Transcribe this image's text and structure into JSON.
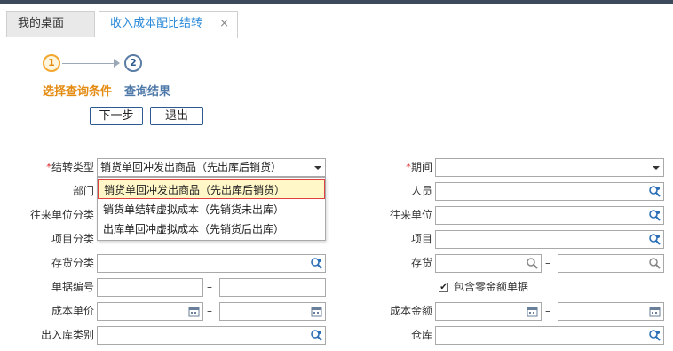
{
  "tabs": {
    "home": "我的桌面",
    "active": "收入成本配比结转",
    "close": "×"
  },
  "steps": [
    {
      "num": "1",
      "label": "选择查询条件"
    },
    {
      "num": "2",
      "label": "查询结果"
    }
  ],
  "buttons": {
    "next": "下一步",
    "exit": "退出"
  },
  "form": {
    "transfer_type": {
      "label": "结转类型",
      "value": "销货单回冲发出商品（先出库后销货）"
    },
    "department": {
      "label": "部门"
    },
    "partner_category": {
      "label": "往来单位分类"
    },
    "project_category": {
      "label": "项目分类"
    },
    "inventory_category": {
      "label": "存货分类"
    },
    "doc_number": {
      "label": "单据编号"
    },
    "cost_price": {
      "label": "成本单价"
    },
    "io_category": {
      "label": "出入库类别"
    },
    "period": {
      "label": "期间",
      "value": ""
    },
    "staff": {
      "label": "人员"
    },
    "partner": {
      "label": "往来单位"
    },
    "project": {
      "label": "项目"
    },
    "inventory": {
      "label": "存货"
    },
    "include_zero": {
      "label": "包含零金额单据",
      "checked": true
    },
    "cost_amount": {
      "label": "成本金额"
    },
    "warehouse": {
      "label": "仓库"
    },
    "required_mark": "*",
    "range_dash": "–"
  },
  "dropdown_options": [
    "销货单回冲发出商品（先出库后销货）",
    "销货单结转虚拟成本（先销货未出库）",
    "出库单回冲虚拟成本（先销货后出库）"
  ],
  "colors": {
    "accent": "#2a8ad8",
    "step_active": "#e48b12",
    "required": "#d33333"
  },
  "icons": {
    "lookup": "magnifier-user-icon",
    "search": "search-icon",
    "calendar": "calendar-icon",
    "dropdown": "caret-down-icon"
  }
}
